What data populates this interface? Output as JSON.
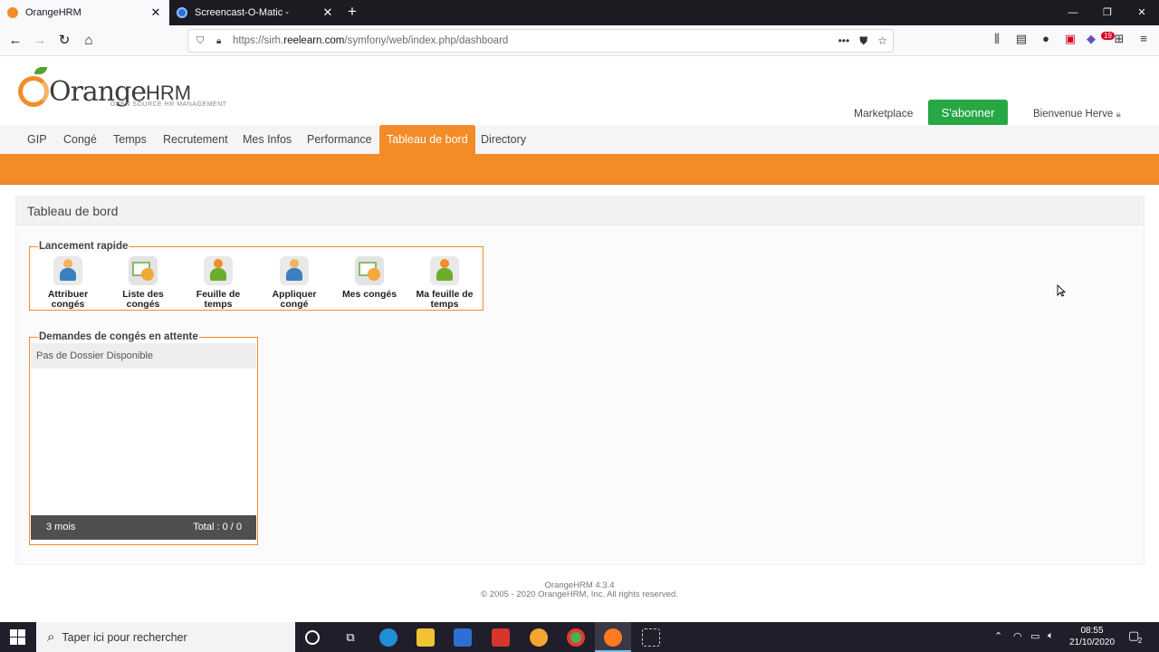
{
  "browser": {
    "tabs": [
      {
        "title": "OrangeHRM",
        "active": true
      },
      {
        "title": "Screencast-O-Matic -",
        "active": false
      }
    ],
    "url_prefix": "https://sirh.",
    "url_domain": "reelearn.com",
    "url_path": "/symfony/web/index.php/dashboard",
    "notification_count": "19"
  },
  "logo": {
    "word": "Orange",
    "hrm": "HRM",
    "tagline": "OPEN SOURCE HR MANAGEMENT"
  },
  "header": {
    "marketplace": "Marketplace",
    "subscribe": "S'abonner",
    "welcome": "Bienvenue Herve"
  },
  "menu": [
    {
      "label": "GIP"
    },
    {
      "label": "Congé"
    },
    {
      "label": "Temps"
    },
    {
      "label": "Recrutement"
    },
    {
      "label": "Mes Infos"
    },
    {
      "label": "Performance"
    },
    {
      "label": "Tableau de bord",
      "active": true
    },
    {
      "label": "Directory"
    }
  ],
  "dashboard": {
    "title": "Tableau de bord",
    "quick_launch": {
      "legend": "Lancement rapide",
      "items": [
        {
          "line1": "Attribuer",
          "line2": "congés",
          "icon": "person-icon"
        },
        {
          "line1": "Liste des",
          "line2": "congés",
          "icon": "calendar-icon"
        },
        {
          "line1": "Feuille de",
          "line2": "temps",
          "icon": "timesheet-icon"
        },
        {
          "line1": "Appliquer",
          "line2": "congé",
          "icon": "person-icon"
        },
        {
          "line1": "Mes congés",
          "line2": "",
          "icon": "calendar-icon"
        },
        {
          "line1": "Ma feuille de",
          "line2": "temps",
          "icon": "timesheet-icon"
        }
      ]
    },
    "pending": {
      "legend": "Demandes de congés en attente",
      "empty": "Pas de Dossier Disponible",
      "period": "3 mois",
      "total": "Total : 0 / 0"
    }
  },
  "footer": {
    "version": "OrangeHRM 4.3.4",
    "copyright": "© 2005 - 2020 OrangeHRM, Inc. All rights reserved."
  },
  "taskbar": {
    "search_placeholder": "Taper ici pour rechercher",
    "time": "08:55",
    "date": "21/10/2020",
    "notif_count": "2"
  }
}
